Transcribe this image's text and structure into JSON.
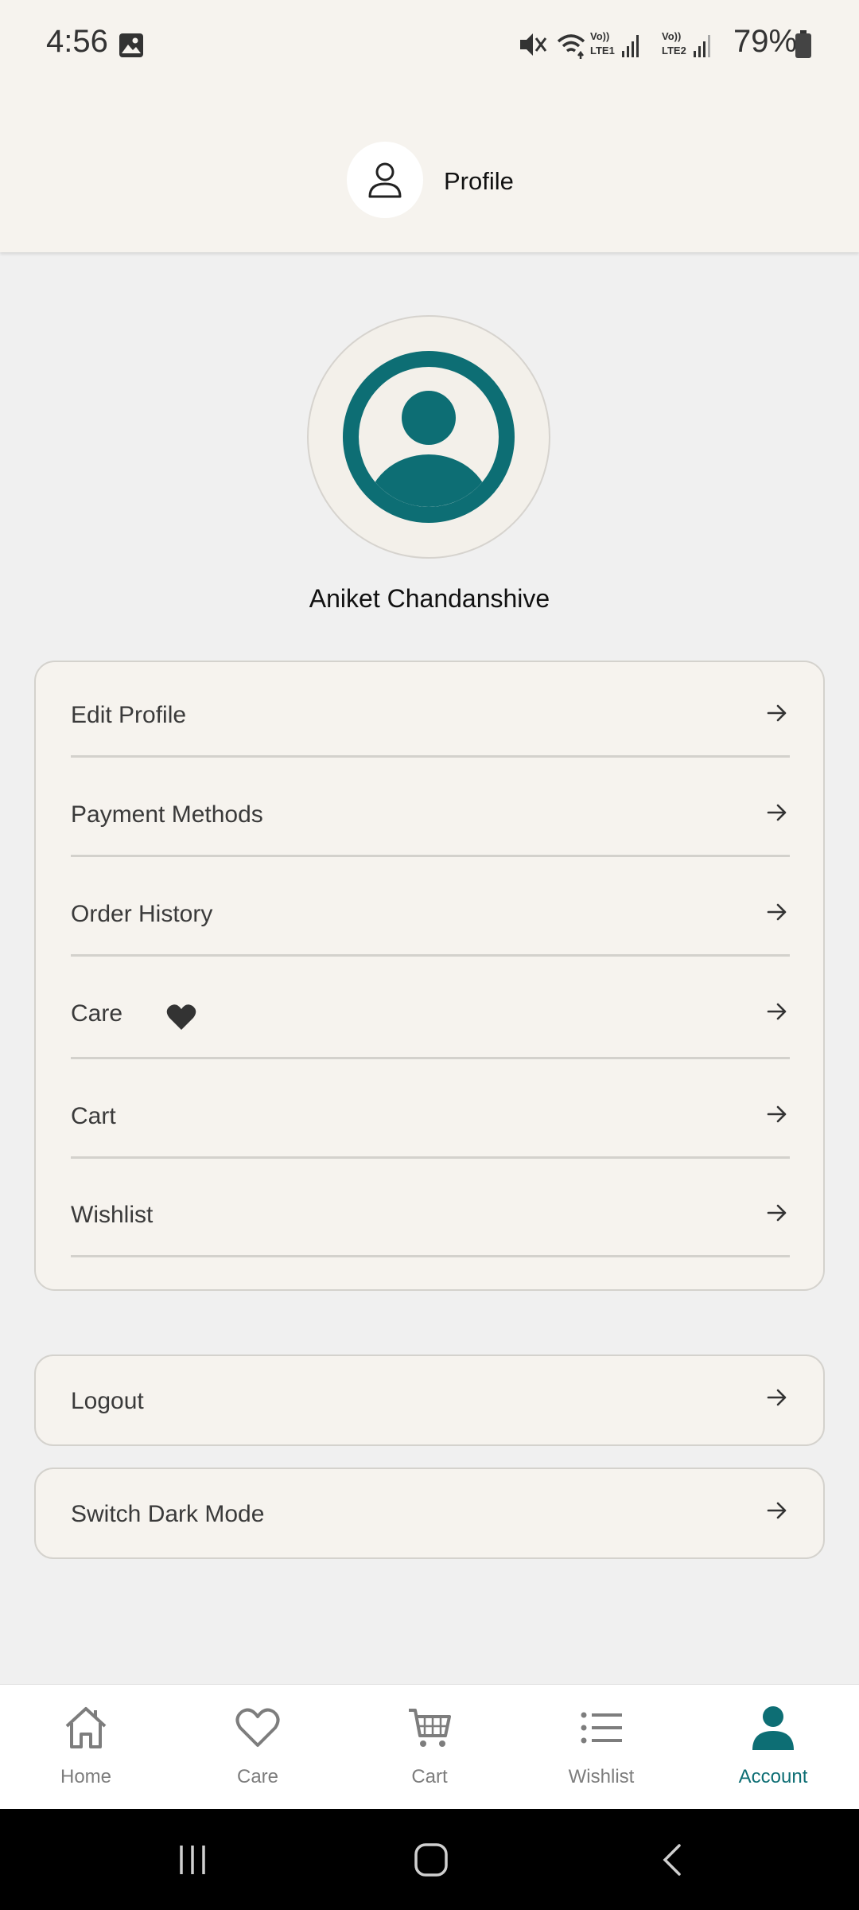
{
  "status_bar": {
    "time": "4:56",
    "battery": "79%",
    "icons": [
      "gallery-icon",
      "mute-icon",
      "wifi-icon",
      "signal-lte1-icon",
      "signal-lte2-icon",
      "battery-icon"
    ]
  },
  "header": {
    "title": "Profile",
    "icon": "person-outline-icon"
  },
  "profile": {
    "name": "Aniket Chandanshive",
    "avatar_color": "#0d6e74"
  },
  "menu": {
    "items": [
      {
        "label": "Edit Profile"
      },
      {
        "label": "Payment Methods"
      },
      {
        "label": "Order History"
      },
      {
        "label": "Care",
        "icon": "heart-icon"
      },
      {
        "label": "Cart"
      },
      {
        "label": "Wishlist"
      }
    ]
  },
  "actions": {
    "logout": "Logout",
    "dark_mode": "Switch Dark Mode"
  },
  "bottom_nav": {
    "items": [
      {
        "label": "Home",
        "icon": "home-icon"
      },
      {
        "label": "Care",
        "icon": "heart-outline-icon"
      },
      {
        "label": "Cart",
        "icon": "cart-icon"
      },
      {
        "label": "Wishlist",
        "icon": "list-icon"
      },
      {
        "label": "Account",
        "icon": "person-filled-icon",
        "active": true
      }
    ],
    "active_color": "#0d6e74"
  },
  "system_nav": [
    "recents-icon",
    "home-circle-icon",
    "back-icon"
  ]
}
